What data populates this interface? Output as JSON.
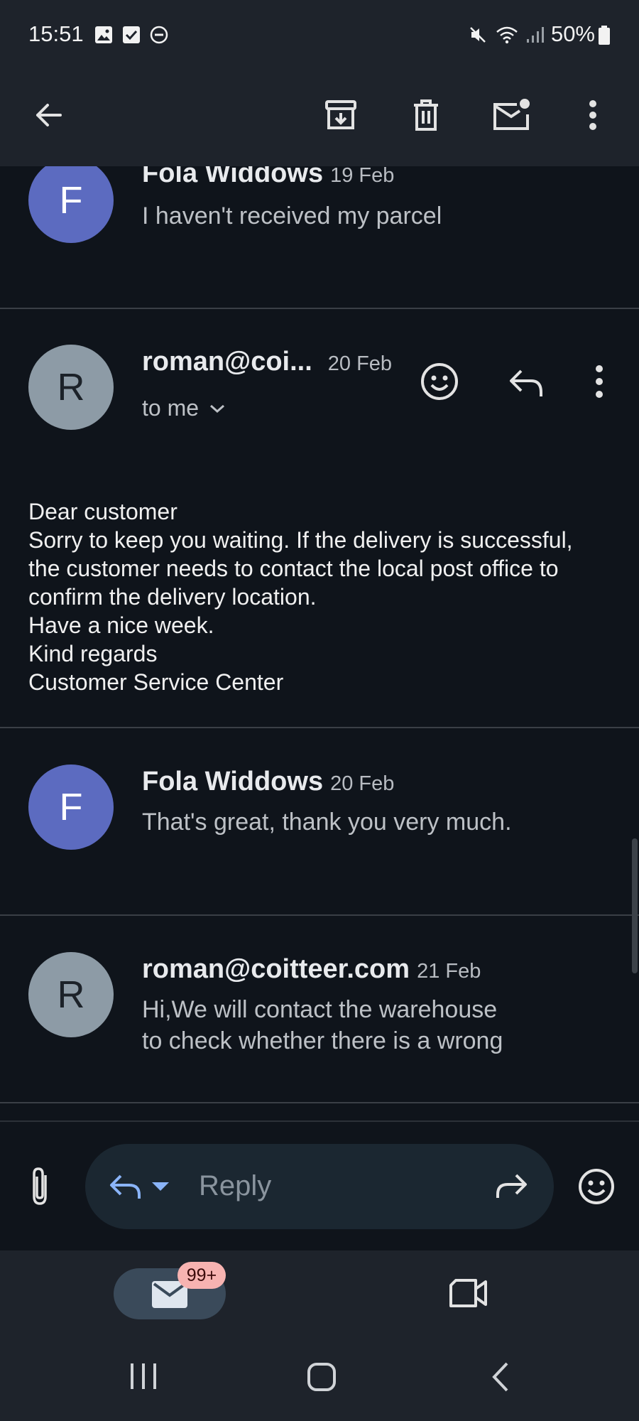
{
  "status_bar": {
    "time": "15:51",
    "battery": "50%"
  },
  "toolbar": {
    "icons": [
      "back-arrow-icon",
      "archive-icon",
      "trash-icon",
      "mark-unread-icon",
      "overflow-menu-icon"
    ]
  },
  "messages": [
    {
      "sender": "Fola Widdows",
      "date": "19 Feb",
      "snippet": "I haven't received my parcel",
      "avatar": "F"
    },
    {
      "sender": "roman@coi...",
      "date": "20 Feb",
      "recipient": "to me",
      "avatar": "R",
      "body": [
        "Dear customer",
        "Sorry to keep you waiting. If the delivery is successful,",
        "the customer needs to contact the local post office to",
        "confirm the delivery location.",
        "Have a nice week.",
        "Kind regards",
        "Customer Service Center"
      ]
    },
    {
      "sender": "Fola Widdows",
      "date": "20 Feb",
      "snippet": "That's great, thank you very much.",
      "avatar": "F"
    },
    {
      "sender": "roman@coitteer.com",
      "date": "21 Feb",
      "avatar": "R",
      "snippet_lines": [
        "Hi,We will contact the warehouse",
        "to check whether there is a wrong"
      ]
    }
  ],
  "reply_bar": {
    "placeholder": "Reply"
  },
  "bottom_nav": {
    "mail_badge": "99+"
  },
  "colors": {
    "background": "#0f141b",
    "bar": "#1e232b",
    "avatar_f": "#5c6bc0",
    "avatar_r": "#8d9ba6",
    "accent": "#8ab4f8"
  }
}
